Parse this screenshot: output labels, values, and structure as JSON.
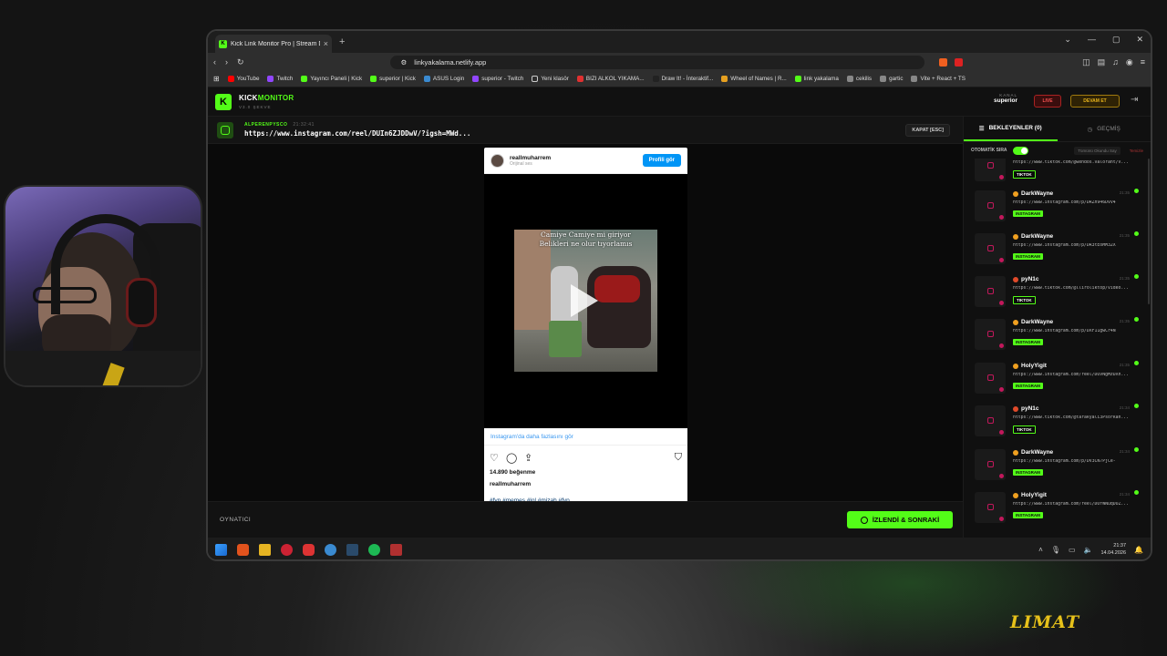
{
  "browser": {
    "tab_title": "Kick Link Monitor Pro | Stream D",
    "url": "linkyakalama.netlify.app",
    "bookmarks": [
      "YouTube",
      "Twitch",
      "Yayıncı Paneli | Kick",
      "superior | Kick",
      "ASUS Login",
      "superior - Twitch",
      "Yeni klasör",
      "BIZI ALKOL YIKAMA...",
      "Draw It! - İnteraktif...",
      "Wheel of Names | R...",
      "link yakalama",
      "cekilis",
      "gartic",
      "Vite + React + TS"
    ]
  },
  "app": {
    "brand_kick": "KICK",
    "brand_monitor": "MONITOR",
    "version": "V3.0 ŞEKVE",
    "channel_label": "KANAL",
    "channel_name": "superior",
    "live_label": "LIVE",
    "continue_label": "DEVAM ET"
  },
  "current_link": {
    "user": "ALPERENPYSCO",
    "time": "21:32:41",
    "url": "https://www.instagram.com/reel/DUIn6ZJDDwV/?igsh=MWd...",
    "close_label": "KAPAT [ESC]"
  },
  "embed": {
    "username": "reallmuharrem",
    "subtitle": "Orijinal ses",
    "profile_button": "Profili gör",
    "caption_line1": "Camiye Camiye mi giriyor",
    "caption_line2": "Belikleri ne olur tıyorlamıs",
    "more_link": "Instagram'da daha fazlasını gör",
    "likes": "14.890 beğenme",
    "author": "reallmuharrem",
    "tags": "#fyp #memes #lol #mizah #fyp"
  },
  "footer": {
    "player_label": "OYNATICI",
    "next_button": "İZLENDİ & SONRAKİ"
  },
  "sidebar": {
    "tab_waiting": "BEKLEYENLER (0)",
    "tab_history": "GEÇMİŞ",
    "auto_label": "OTOMATİK SIRA",
    "mark_all": "Tümünü Okundu Say",
    "clear": "Temizle",
    "items": [
      {
        "user": "",
        "time": "",
        "url": "https://www.tiktok.com/@wendos.valorant/v...",
        "tag": "TIKTOK"
      },
      {
        "user": "DarkWayne",
        "time": "21:35",
        "url": "https://www.instagram.com/p/DRZn946DVv4",
        "tag": "INSTAGRAM"
      },
      {
        "user": "DarkWayne",
        "time": "21:35",
        "url": "https://www.instagram.com/p/DR3tEoMM32X",
        "tag": "INSTAGRAM"
      },
      {
        "user": "pyN1c",
        "time": "21:35",
        "url": "https://www.tiktok.com/@lliroliktop/video...",
        "tag": "TIKTOK"
      },
      {
        "user": "DarkWayne",
        "time": "21:35",
        "url": "https://www.instagram.com/p/DXF11gwCr4N",
        "tag": "INSTAGRAM"
      },
      {
        "user": "HolyYigit",
        "time": "21:35",
        "url": "https://www.instagram.com/reel/DUVNgMzDXh...",
        "tag": "INSTAGRAM"
      },
      {
        "user": "pyN1c",
        "time": "21:34",
        "url": "https://www.tiktok.com/@tarakyali3Psorkan...",
        "tag": "TIKTOK"
      },
      {
        "user": "DarkWayne",
        "time": "21:34",
        "url": "https://www.instagram.com/p/DV3CN7PjCe-",
        "tag": "INSTAGRAM"
      },
      {
        "user": "HolyYigit",
        "time": "21:34",
        "url": "https://www.instagram.com/reel/DUfWNuqDUZ...",
        "tag": "INSTAGRAM"
      }
    ]
  },
  "taskbar": {
    "time": "21:37",
    "date": "14.04.2026"
  },
  "watermark": "LIMAT"
}
